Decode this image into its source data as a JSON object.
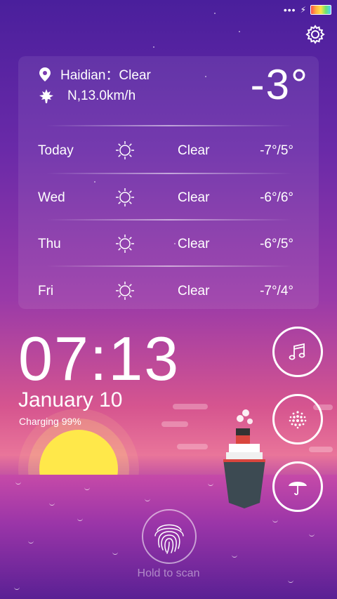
{
  "status_bar": {
    "dots": "•••",
    "charging_icon": "lightning-bolt-icon",
    "battery_icon": "battery-icon"
  },
  "weather": {
    "location": "Haidian：Clear",
    "wind": "N,13.0km/h",
    "current_temp": "-3°",
    "forecast": [
      {
        "day": "Today",
        "icon": "sun-icon",
        "condition": "Clear",
        "range": "-7°/5°"
      },
      {
        "day": "Wed",
        "icon": "sun-icon",
        "condition": "Clear",
        "range": "-6°/6°"
      },
      {
        "day": "Thu",
        "icon": "sun-icon",
        "condition": "Clear",
        "range": "-6°/5°"
      },
      {
        "day": "Fri",
        "icon": "sun-icon",
        "condition": "Clear",
        "range": "-7°/4°"
      }
    ]
  },
  "lockscreen": {
    "time": "07:13",
    "date": "January 10",
    "charging": "Charging 99%",
    "hint": "Hold to scan"
  },
  "shortcuts": [
    "music-note-icon",
    "dots-sphere-icon",
    "umbrella-icon"
  ]
}
